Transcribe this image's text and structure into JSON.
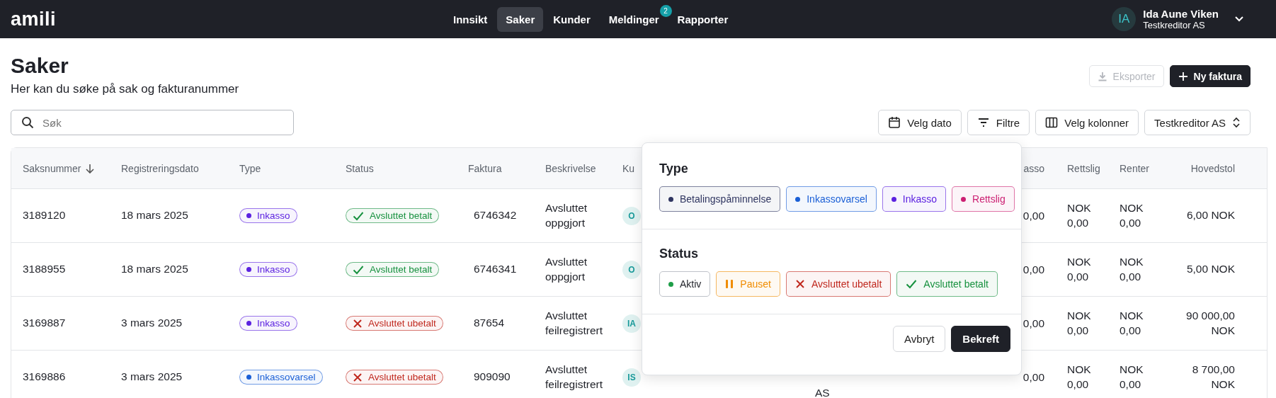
{
  "topbar": {
    "logo": "amili",
    "nav": [
      {
        "label": "Innsikt",
        "selected": false
      },
      {
        "label": "Saker",
        "selected": true
      },
      {
        "label": "Kunder",
        "selected": false
      },
      {
        "label": "Meldinger",
        "selected": false,
        "badge": "2"
      },
      {
        "label": "Rapporter",
        "selected": false
      }
    ],
    "user": {
      "initials": "IA",
      "name": "Ida Aune Viken",
      "company": "Testkreditor AS"
    }
  },
  "page": {
    "title": "Saker",
    "subtitle": "Her kan du søke på sak og fakturanummer",
    "actions": [
      {
        "label": "Eksporter",
        "kind": "export",
        "primary": false,
        "disabled": true
      },
      {
        "label": "Ny faktura",
        "kind": "add",
        "primary": true,
        "disabled": false
      }
    ],
    "search": {
      "placeholder": "Søk"
    },
    "toolbar": [
      {
        "label": "Velg dato",
        "kind": "calendar"
      },
      {
        "label": "Filtre",
        "kind": "filter"
      },
      {
        "label": "Velg kolonner",
        "kind": "columns"
      },
      {
        "label": "Testkreditor AS",
        "kind": "select"
      }
    ]
  },
  "table": {
    "columns": [
      {
        "label": "Saksnummer",
        "sorted": true
      },
      {
        "label": "Registreringsdato",
        "sorted": false
      },
      {
        "label": "Type",
        "sorted": false
      },
      {
        "label": "Status",
        "sorted": false
      },
      {
        "label": "Faktura",
        "sorted": false
      },
      {
        "label": "Beskrivelse",
        "sorted": false
      },
      {
        "label": "Ku",
        "sorted": false
      },
      {
        "label": "asso",
        "sorted": false
      },
      {
        "label": "Rettslig",
        "sorted": false
      },
      {
        "label": "Renter",
        "sorted": false
      },
      {
        "label": "Hovedstol",
        "sorted": false
      }
    ],
    "rows": [
      {
        "saksnummer": "3189120",
        "registreringsdato": "18 mars 2025",
        "type": {
          "label": "Inkasso",
          "color": "#5b21e0"
        },
        "status": {
          "label": "Avsluttet betalt",
          "kind": "check",
          "color": "#17913f"
        },
        "faktura": "6746342",
        "beskrivelse": "Avsluttet oppgjort",
        "column_7": "O",
        "column_9": "0,00",
        "rettslig": "NOK 0,00",
        "renter": "NOK 0,00",
        "hovedstol": "6,00 NOK"
      },
      {
        "saksnummer": "3188955",
        "registreringsdato": "18 mars 2025",
        "type": {
          "label": "Inkasso",
          "color": "#5b21e0"
        },
        "status": {
          "label": "Avsluttet betalt",
          "kind": "check",
          "color": "#17913f"
        },
        "faktura": "6746341",
        "beskrivelse": "Avsluttet oppgjort",
        "column_7": "O",
        "column_9": "0,00",
        "rettslig": "NOK 0,00",
        "renter": "NOK 0,00",
        "hovedstol": "5,00 NOK"
      },
      {
        "saksnummer": "3169887",
        "registreringsdato": "3 mars 2025",
        "type": {
          "label": "Inkasso",
          "color": "#5b21e0"
        },
        "status": {
          "label": "Avsluttet ubetalt",
          "kind": "cross",
          "color": "#c0281e"
        },
        "faktura": "87654",
        "beskrivelse": "Avsluttet feilregistrert",
        "column_7": "IA",
        "column_9": "0,00",
        "rettslig": "NOK 0,00",
        "renter": "NOK 0,00",
        "hovedstol": "90 000,00 NOK"
      },
      {
        "saksnummer": "3169886",
        "registreringsdato": "3 mars 2025",
        "type": {
          "label": "Inkassovarsel",
          "color": "#1a5fd6"
        },
        "status": {
          "label": "Avsluttet ubetalt",
          "kind": "cross",
          "color": "#c0281e"
        },
        "faktura": "909090",
        "beskrivelse": "Avsluttet feilregistrert",
        "column_7": "IS",
        "column_8": "AS",
        "column_9": "0,00",
        "rettslig": "NOK 0,00",
        "renter": "NOK 0,00",
        "hovedstol": "8 700,00 NOK"
      }
    ]
  },
  "filter_popup": {
    "sections": [
      {
        "title": "Type",
        "chips": [
          {
            "label": "Betalingspåminnelse",
            "kind": "dot",
            "color": "#2f3560"
          },
          {
            "label": "Inkassovarsel",
            "kind": "dot",
            "color": "#1a5fd6"
          },
          {
            "label": "Inkasso",
            "kind": "dot",
            "color": "#5b21e0"
          },
          {
            "label": "Rettslig",
            "kind": "dot",
            "color": "#cc1f72"
          }
        ]
      },
      {
        "title": "Status",
        "chips": [
          {
            "label": "Aktiv",
            "kind": "plain",
            "color": "#1e9e48"
          },
          {
            "label": "Pauset",
            "kind": "pause",
            "color": "#f08c00"
          },
          {
            "label": "Avsluttet ubetalt",
            "kind": "cross",
            "color": "#c0281e"
          },
          {
            "label": "Avsluttet betalt",
            "kind": "check",
            "color": "#17913f"
          }
        ]
      }
    ],
    "buttons": [
      {
        "label": "Avbryt",
        "primary": false
      },
      {
        "label": "Bekreft",
        "primary": true
      }
    ]
  }
}
